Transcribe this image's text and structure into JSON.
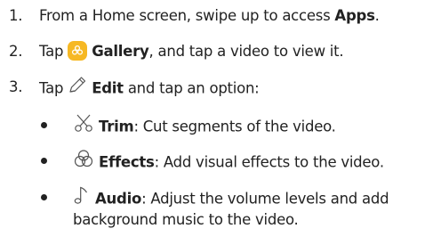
{
  "steps": [
    {
      "number": "1.",
      "text_before": "From a Home screen, swipe up to access ",
      "bold": "Apps",
      "text_after": "."
    },
    {
      "number": "2.",
      "text_before": "Tap ",
      "icon": "gallery-app-icon",
      "bold": "Gallery",
      "text_after": ", and tap a video to view it."
    },
    {
      "number": "3.",
      "text_before": "Tap ",
      "icon": "edit-pencil-icon",
      "bold": "Edit",
      "text_after": " and tap an option:"
    }
  ],
  "options": [
    {
      "icon": "trim-scissors-icon",
      "bold": "Trim",
      "text": ": Cut segments of the video."
    },
    {
      "icon": "effects-icon",
      "bold": "Effects",
      "text": ": Add visual effects to the video."
    },
    {
      "icon": "audio-note-icon",
      "bold": "Audio",
      "text": ": Adjust the volume levels and add",
      "continuation": "background music to the video."
    }
  ],
  "colors": {
    "text": "#222222",
    "gallery_icon": "#f6b824",
    "icon_stroke": "#555555"
  }
}
